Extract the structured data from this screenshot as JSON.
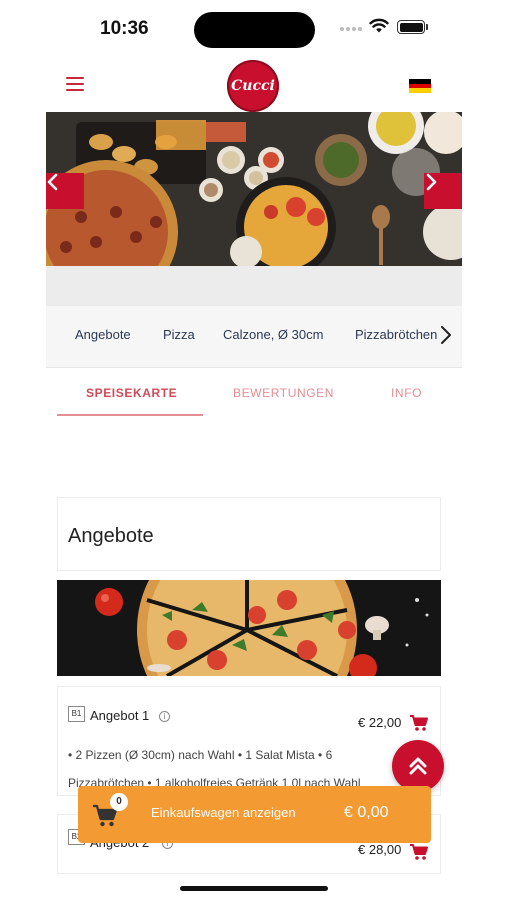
{
  "status_bar": {
    "time": "10:36"
  },
  "header": {
    "logo_text": "Cucci",
    "language_flag_colors": [
      "#000000",
      "#dd0000",
      "#ffce00"
    ]
  },
  "hero": {
    "prev_icon": "chevron-left-icon",
    "next_icon": "chevron-right-icon"
  },
  "categories": [
    "Angebote",
    "Pizza",
    "Calzone, Ø 30cm",
    "Pizzabrötchen"
  ],
  "tabs": [
    {
      "label": "SPEISEKARTE",
      "active": true
    },
    {
      "label": "BEWERTUNGEN",
      "active": false
    },
    {
      "label": "INFO",
      "active": false
    }
  ],
  "section": {
    "title": "Angebote"
  },
  "items": [
    {
      "code": "B1",
      "name": "Angebot 1",
      "price": "€ 22,00",
      "description_lines": [
        "• 2 Pizzen (Ø 30cm) nach Wahl • 1 Salat Mista • 6",
        "Pizzabrötchen • 1 alkoholfreies Getränk 1,0l nach Wahl"
      ]
    },
    {
      "code": "B2",
      "name": "Angebot 2",
      "price": "€ 28,00"
    }
  ],
  "cart": {
    "count": "0",
    "label": "Einkaufswagen anzeigen",
    "total": "€ 0,00"
  },
  "colors": {
    "brand_red": "#c8102e",
    "tab_pink": "#e58d94",
    "cart_orange": "#f39a32",
    "category_text": "#2c3a55"
  }
}
